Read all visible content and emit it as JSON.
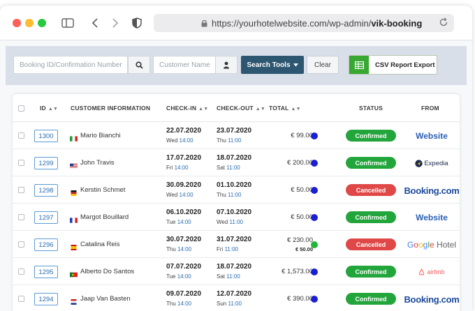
{
  "browser": {
    "url_prefix": "https://yourhotelwebsite.com/wp-admin/",
    "url_bold": "vik-booking"
  },
  "toolbar": {
    "booking_placeholder": "Booking ID/Confirmation Number",
    "customer_placeholder": "Customer Name",
    "search_tools_label": "Search Tools",
    "clear_label": "Clear",
    "csv_label": "CSV Report Export"
  },
  "table": {
    "headers": {
      "id": "ID",
      "customer": "CUSTOMER INFORMATION",
      "checkin": "CHECK-IN",
      "checkout": "CHECK-OUT",
      "total": "TOTAL",
      "status": "STATUS",
      "from": "FROM"
    },
    "rows": [
      {
        "id": "1300",
        "flag": "it",
        "name": "Mario Bianchi",
        "checkin_date": "22.07.2020",
        "checkin_day": "Wed",
        "checkin_time": "14:00",
        "checkout_date": "23.07.2020",
        "checkout_day": "Thu",
        "checkout_time": "11:00",
        "total": "€ 99.00",
        "total_sub": "",
        "dot_color": "#1a1fd6",
        "status": "Confirmed",
        "status_color": "#22a53a",
        "from": "Website"
      },
      {
        "id": "1299",
        "flag": "us",
        "name": "John Travis",
        "checkin_date": "17.07.2020",
        "checkin_day": "Fri",
        "checkin_time": "14:00",
        "checkout_date": "18.07.2020",
        "checkout_day": "Sat",
        "checkout_time": "11:00",
        "total": "€ 200.00",
        "total_sub": "",
        "dot_color": "#1a1fd6",
        "status": "Confirmed",
        "status_color": "#22a53a",
        "from": "Expedia"
      },
      {
        "id": "1298",
        "flag": "de",
        "name": "Kerstin Schmet",
        "checkin_date": "30.09.2020",
        "checkin_day": "Wed",
        "checkin_time": "14:00",
        "checkout_date": "01.10.2020",
        "checkout_day": "Thu",
        "checkout_time": "11:00",
        "total": "€ 50.00",
        "total_sub": "",
        "dot_color": "#1a1fd6",
        "status": "Cancelled",
        "status_color": "#e04848",
        "from": "Booking.com"
      },
      {
        "id": "1297",
        "flag": "fr",
        "name": "Margot Bouillard",
        "checkin_date": "06.10.2020",
        "checkin_day": "Tue",
        "checkin_time": "14:00",
        "checkout_date": "07.10.2020",
        "checkout_day": "Wed",
        "checkout_time": "11:00",
        "total": "€ 50.00",
        "total_sub": "",
        "dot_color": "#1a1fd6",
        "status": "Confirmed",
        "status_color": "#22a53a",
        "from": "Website"
      },
      {
        "id": "1296",
        "flag": "es",
        "name": "Catalina Reis",
        "checkin_date": "30.07.2020",
        "checkin_day": "Thu",
        "checkin_time": "14:00",
        "checkout_date": "31.07.2020",
        "checkout_day": "Fri",
        "checkout_time": "11:00",
        "total": "€ 230.00",
        "total_sub": "€ 50.00",
        "dot_color": "#22b536",
        "status": "Cancelled",
        "status_color": "#e04848",
        "from": "Google Hotel"
      },
      {
        "id": "1295",
        "flag": "pt",
        "name": "Alberto Do Santos",
        "checkin_date": "07.07.2020",
        "checkin_day": "Tue",
        "checkin_time": "14:00",
        "checkout_date": "18.07.2020",
        "checkout_day": "Sat",
        "checkout_time": "11:00",
        "total": "€ 1,573.00",
        "total_sub": "",
        "dot_color": "#1a1fd6",
        "status": "Confirmed",
        "status_color": "#22a53a",
        "from": "airbnb"
      },
      {
        "id": "1294",
        "flag": "nl",
        "name": "Jaap Van Basten",
        "checkin_date": "09.07.2020",
        "checkin_day": "Thu",
        "checkin_time": "14:00",
        "checkout_date": "12.07.2020",
        "checkout_day": "Sun",
        "checkout_time": "11:00",
        "total": "€ 390.00",
        "total_sub": "",
        "dot_color": "#1a1fd6",
        "status": "Confirmed",
        "status_color": "#22a53a",
        "from": "Booking.com"
      }
    ]
  },
  "colors": {
    "search_button": "#2d5670",
    "csv_green": "#38a833",
    "id_blue": "#2b6cb0"
  }
}
